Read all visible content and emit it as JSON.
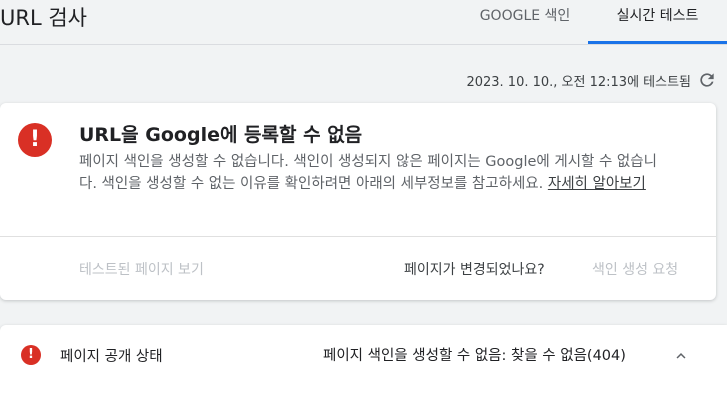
{
  "header": {
    "title": "URL 검사",
    "tabs": [
      {
        "label": "GOOGLE 색인",
        "active": false
      },
      {
        "label": "실시간 테스트",
        "active": true
      }
    ],
    "accent_color": "#1a73e8"
  },
  "status": {
    "tested_at": "2023. 10. 10., 오전 12:13에 테스트됨",
    "refresh_icon": "refresh-icon"
  },
  "main_card": {
    "status_icon": "error-icon",
    "status_color": "#d93025",
    "title": "URL을 Google에 등록할 수 없음",
    "description": "페이지 색인을 생성할 수 없습니다. 색인이 생성되지 않은 페이지는 Google에 게시할 수 없습니다. 색인을 생성할 수 없는 이유를 확인하려면 아래의 세부정보를 참고하세요.",
    "learn_more": "자세히 알아보기",
    "view_tested_page": "테스트된 페이지 보기",
    "page_changed_question": "페이지가 변경되었나요?",
    "request_indexing": "색인 생성 요청"
  },
  "availability": {
    "status_icon": "error-icon",
    "label": "페이지 공개 상태",
    "value": "페이지 색인을 생성할 수 없음: 찾을 수 없음(404)",
    "toggle_icon": "chevron-up-icon"
  }
}
